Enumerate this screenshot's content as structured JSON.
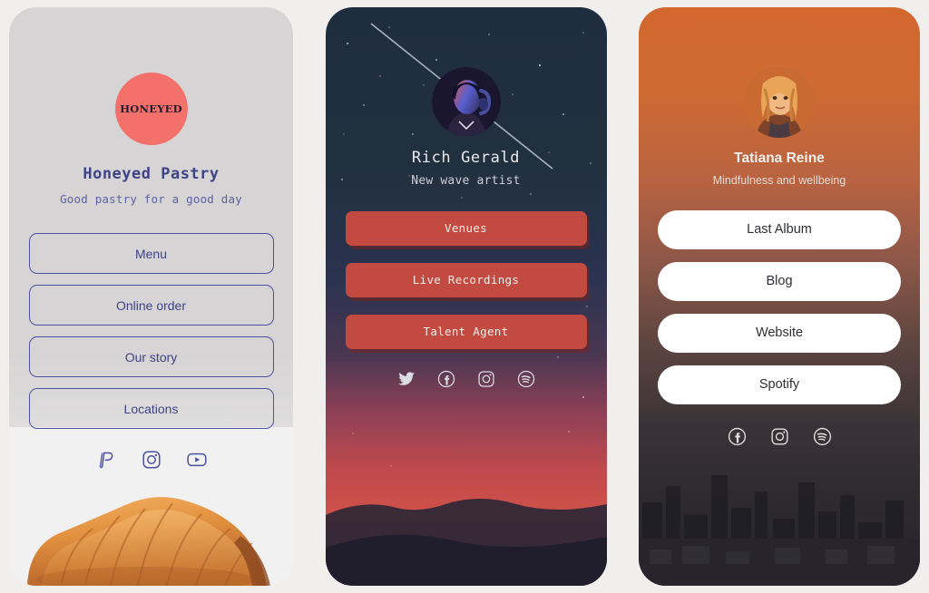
{
  "page": {
    "background_color": "#f0efed",
    "layout": "three link-in-bio profile cards side by side"
  },
  "cards": [
    {
      "id": "honeyed-pastry",
      "theme": {
        "background_color": "#d6d4d5",
        "accent_color": "#f4706a",
        "text_color": "#3f4386",
        "button_border_color": "#4d51a0"
      },
      "logo_text": "HONEYED",
      "title": "Honeyed Pastry",
      "subtitle": "Good pastry for a good day",
      "buttons": [
        {
          "label": "Menu"
        },
        {
          "label": "Online order"
        },
        {
          "label": "Our story"
        },
        {
          "label": "Locations"
        }
      ],
      "socials": [
        {
          "icon": "paypal-icon",
          "label": "PayPal"
        },
        {
          "icon": "instagram-icon",
          "label": "Instagram"
        },
        {
          "icon": "youtube-icon",
          "label": "YouTube"
        }
      ],
      "hero_image": "croissant-photo"
    },
    {
      "id": "rich-gerald",
      "theme": {
        "background_top_color": "#1f2e3f",
        "background_bottom_color": "#d05149",
        "accent_color": "#c24a41",
        "text_color": "#e9e8ef"
      },
      "avatar": "artist-portrait-headphones",
      "title": "Rich Gerald",
      "subtitle": "New wave artist",
      "buttons": [
        {
          "label": "Venues"
        },
        {
          "label": "Live Recordings"
        },
        {
          "label": "Talent Agent"
        }
      ],
      "socials": [
        {
          "icon": "twitter-icon",
          "label": "Twitter"
        },
        {
          "icon": "facebook-icon",
          "label": "Facebook"
        },
        {
          "icon": "instagram-icon",
          "label": "Instagram"
        },
        {
          "icon": "spotify-icon",
          "label": "Spotify"
        }
      ],
      "hero_image": "sunset-mountain-landscape"
    },
    {
      "id": "tatiana-reine",
      "theme": {
        "background_top_color": "#d2682e",
        "background_bottom_color": "#27252b",
        "accent_color": "#ffffff",
        "text_color": "#f3f0ee"
      },
      "avatar": "woman-portrait",
      "title": "Tatiana Reine",
      "subtitle": "Mindfulness and wellbeing",
      "buttons": [
        {
          "label": "Last Album"
        },
        {
          "label": "Blog"
        },
        {
          "label": "Website"
        },
        {
          "label": "Spotify"
        }
      ],
      "socials": [
        {
          "icon": "facebook-icon",
          "label": "Facebook"
        },
        {
          "icon": "instagram-icon",
          "label": "Instagram"
        },
        {
          "icon": "spotify-icon",
          "label": "Spotify"
        }
      ],
      "hero_image": "city-skyline-silhouette"
    }
  ]
}
